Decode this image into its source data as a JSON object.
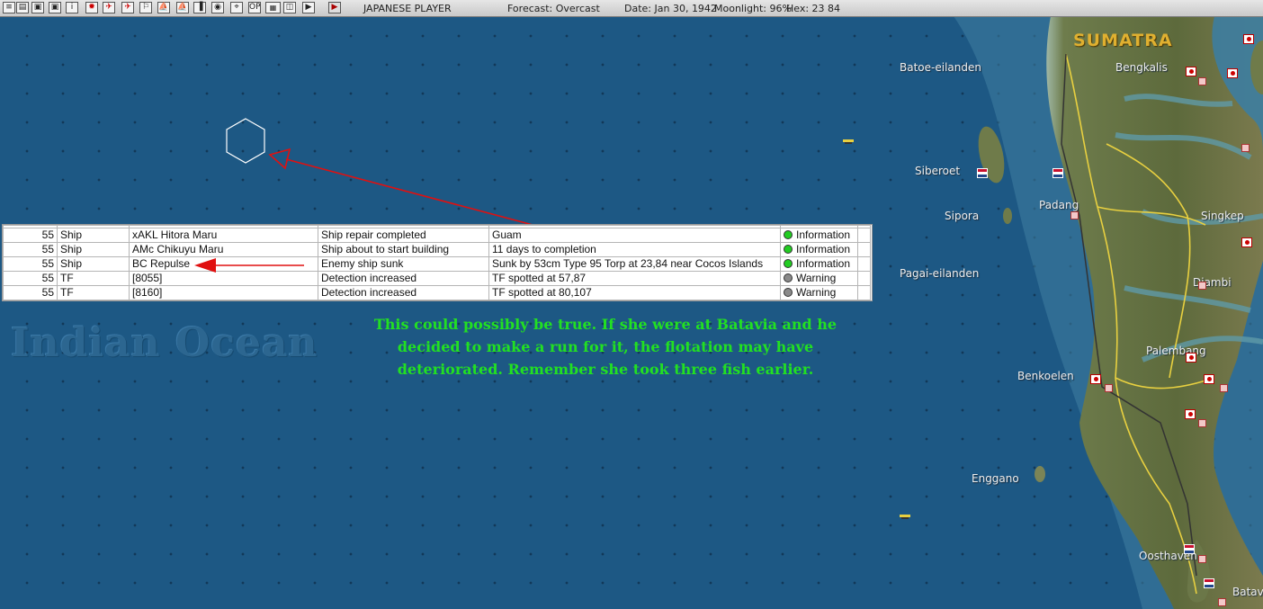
{
  "toolbar": {
    "buttons": [
      "≡",
      "▤",
      "▣",
      "▣",
      "i",
      "✹",
      "✈",
      "✈",
      "⚐",
      "⛵",
      "⛵",
      "▐",
      "◉",
      "⌖",
      "OP",
      "▦",
      "◫",
      "▶"
    ],
    "player": "JAPANESE PLAYER",
    "forecast": "Forecast: Overcast",
    "date": "Date: Jan 30, 1942",
    "moonlight": "Moonlight: 96%",
    "hex": "Hex: 23 84"
  },
  "map": {
    "ocean_label": "Indian Ocean",
    "region_label": "SUMATRA",
    "places": {
      "batoe": "Batoe-eilanden",
      "siberoet": "Siberoet",
      "sipora": "Sipora",
      "pagai": "Pagai-eilanden",
      "benkoelen": "Benkoelen",
      "enggano": "Enggano",
      "oosthaven": "Oosthaven",
      "batavia": "Batav",
      "bengkalis": "Bengkalis",
      "padang": "Padang",
      "singkep": "Singkep",
      "djambi": "Djambi",
      "palembang": "Palembang"
    }
  },
  "messages": {
    "rows": [
      {
        "turn": "55",
        "kind": "Ship",
        "unit": "xAKL Hitora Maru",
        "event": "Ship repair completed",
        "detail": "Guam",
        "level": "Information",
        "status": "green"
      },
      {
        "turn": "55",
        "kind": "Ship",
        "unit": "AMc Chikuyu Maru",
        "event": "Ship about to start building",
        "detail": "11 days to completion",
        "level": "Information",
        "status": "green"
      },
      {
        "turn": "55",
        "kind": "Ship",
        "unit": "BC Repulse",
        "event": "Enemy ship sunk",
        "detail": "Sunk by 53cm Type 95 Torp at 23,84 near Cocos Islands",
        "level": "Information",
        "status": "green"
      },
      {
        "turn": "55",
        "kind": "TF",
        "unit": " [8055]",
        "event": "Detection increased",
        "detail": "TF spotted at 57,87",
        "level": "Warning",
        "status": "gray"
      },
      {
        "turn": "55",
        "kind": "TF",
        "unit": " [8160]",
        "event": "Detection increased",
        "detail": "TF spotted at 80,107",
        "level": "Warning",
        "status": "gray"
      }
    ]
  },
  "annotation": {
    "lines": [
      "This could possibly be true.  If she were at Batavia and he",
      "decided to make a run for it, the flotation may have",
      "deteriorated.  Remember she took three fish earlier."
    ]
  },
  "colors": {
    "ocean": "#1d5884",
    "annotation": "#22e022",
    "arrow": "#e01010",
    "land": "#6f7a4a"
  }
}
